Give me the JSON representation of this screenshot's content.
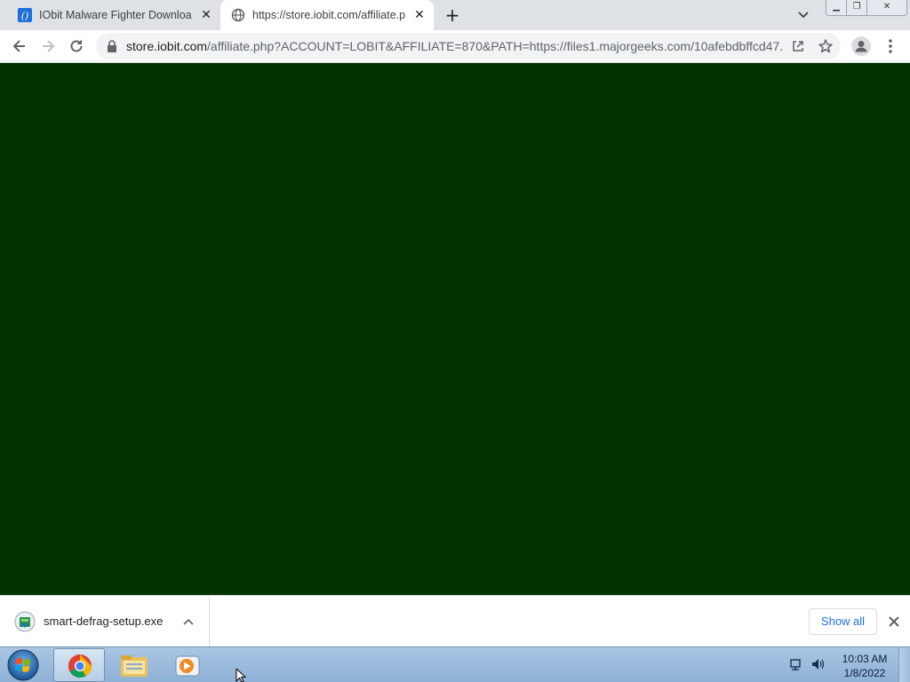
{
  "tabs": [
    {
      "title": "IObit Malware Fighter Download",
      "favicon": "iobit-icon",
      "active": false
    },
    {
      "title": "https://store.iobit.com/affiliate.php",
      "favicon": "globe-icon",
      "active": true
    }
  ],
  "new_tab_label": "+",
  "address": {
    "host": "store.iobit.com",
    "path": "/affiliate.php?ACCOUNT=LOBIT&AFFILIATE=870&PATH=https://files1.majorgeeks.com/10afebdbffcd47..."
  },
  "page": {
    "background": "#003300"
  },
  "download": {
    "filename": "smart-defrag-setup.exe",
    "show_all": "Show all"
  },
  "taskbar": {
    "time": "10:03 AM",
    "date": "1/8/2022"
  }
}
